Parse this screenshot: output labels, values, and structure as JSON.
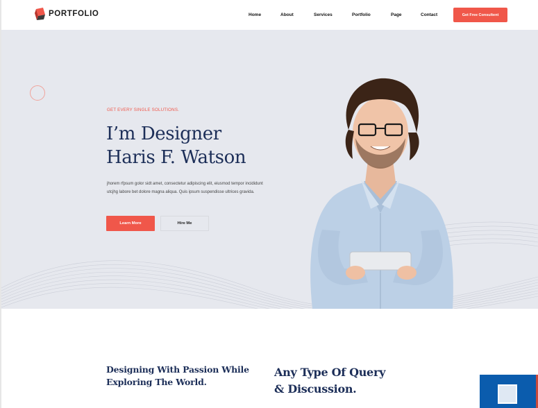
{
  "header": {
    "logo_text": "PORTFOLIO",
    "nav": [
      {
        "label": "Home"
      },
      {
        "label": "About"
      },
      {
        "label": "Services"
      },
      {
        "label": "Portfolio"
      },
      {
        "label": "Page"
      },
      {
        "label": "Contact"
      }
    ],
    "cta_label": "Get Free Consultent"
  },
  "hero": {
    "eyebrow": "GET EVERY SINGLE SOLUTIONS.",
    "headline_line1": "I’m Designer",
    "headline_line2": "Haris F. Watson",
    "description": "jhorem rfpsum golor sidt amet, consectetur adipiscing elit, eiusmod tempor incididunt utcjhg labore bet dolore magna aliqua. Quis ipsum suspendisse ultrices gravida.",
    "primary_button": "Learn More",
    "secondary_button": "Hire Me"
  },
  "section": {
    "left_line1": "Designing With Passion While",
    "left_line2": "Exploring The World.",
    "right_line1": "Any Type Of Query",
    "right_line2": "& Discussion."
  },
  "colors": {
    "accent": "#f0574a",
    "navy": "#1c2e58",
    "hero_bg": "#e6e8ee",
    "widget_blue": "#0b5cad"
  },
  "icons": {
    "logo": "logo-cube-icon",
    "widget": "chat-widget-icon"
  }
}
